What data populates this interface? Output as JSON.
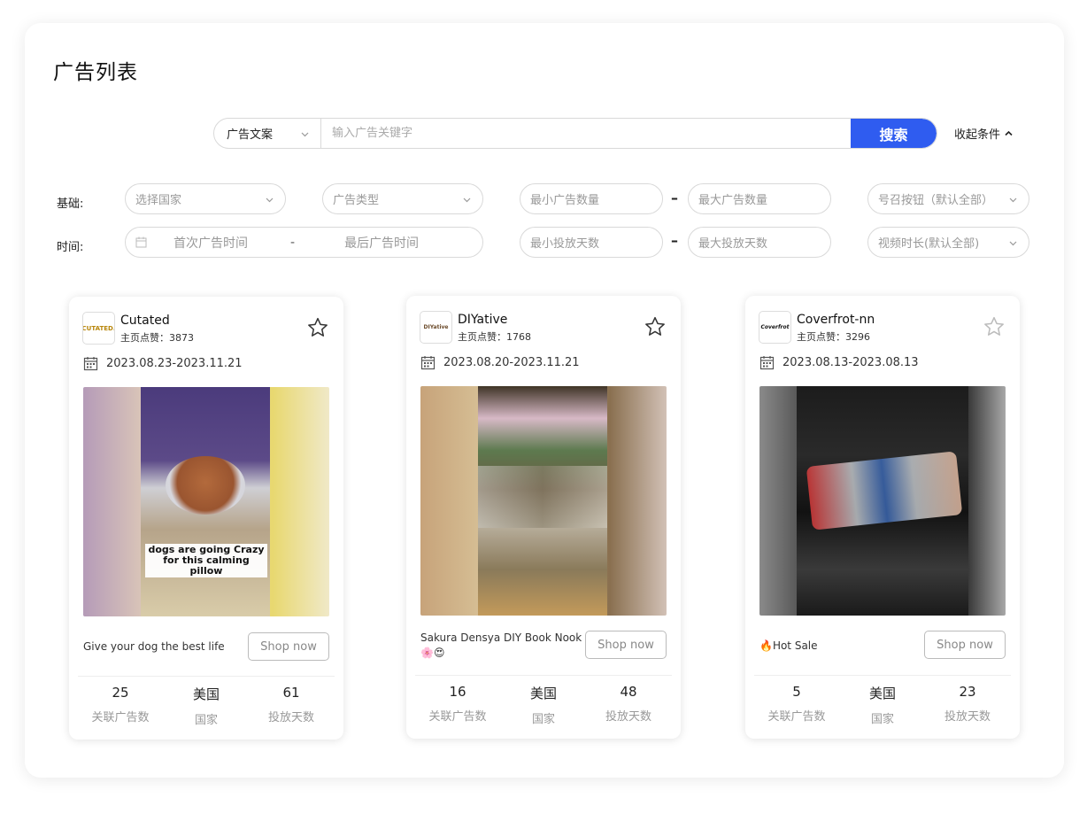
{
  "page": {
    "title": "广告列表"
  },
  "search": {
    "type_label": "广告文案",
    "placeholder": "输入广告关键字",
    "button_label": "搜索",
    "collapse_label": "收起条件"
  },
  "filters": {
    "basic_label": "基础:",
    "time_label": "时间:",
    "country_placeholder": "选择国家",
    "ad_type_placeholder": "广告类型",
    "min_ads_placeholder": "最小广告数量",
    "max_ads_placeholder": "最大广告数量",
    "cta_placeholder": "号召按钮（默认全部）",
    "first_time_placeholder": "首次广告时间",
    "last_time_placeholder": "最后广告时间",
    "min_days_placeholder": "最小投放天数",
    "max_days_placeholder": "最大投放天数",
    "video_len_placeholder": "视频时长(默认全部)",
    "range_sep": "-",
    "dash": "–"
  },
  "cards": [
    {
      "logo_text": "CUTATED.",
      "brand": "Cutated",
      "likes": "主页点赞：3873",
      "date_range": "2023.08.23-2023.11.21",
      "caption": "dogs are going Crazy for this calming pillow",
      "copy": "Give your dog the best life",
      "shop_label": "Shop now",
      "stats": [
        {
          "value": "25",
          "label": "关联广告数"
        },
        {
          "value": "美国",
          "label": "国家"
        },
        {
          "value": "61",
          "label": "投放天数"
        }
      ]
    },
    {
      "logo_text": "DIYative",
      "brand": "DIYative",
      "likes": "主页点赞：1768",
      "date_range": "2023.08.20-2023.11.21",
      "copy": "Sakura Densya DIY Book Nook 🌸😍",
      "shop_label": "Shop now",
      "stats": [
        {
          "value": "16",
          "label": "关联广告数"
        },
        {
          "value": "美国",
          "label": "国家"
        },
        {
          "value": "48",
          "label": "投放天数"
        }
      ]
    },
    {
      "logo_text": "Coverfrot",
      "brand": "Coverfrot-nn",
      "likes": "主页点赞：3296",
      "date_range": "2023.08.13-2023.08.13",
      "copy": "🔥Hot Sale",
      "shop_label": "Shop now",
      "stats": [
        {
          "value": "5",
          "label": "关联广告数"
        },
        {
          "value": "美国",
          "label": "国家"
        },
        {
          "value": "23",
          "label": "投放天数"
        }
      ]
    }
  ],
  "colors": {
    "primary": "#2f5cf0",
    "border": "#d9d9d9",
    "muted": "#999999"
  }
}
